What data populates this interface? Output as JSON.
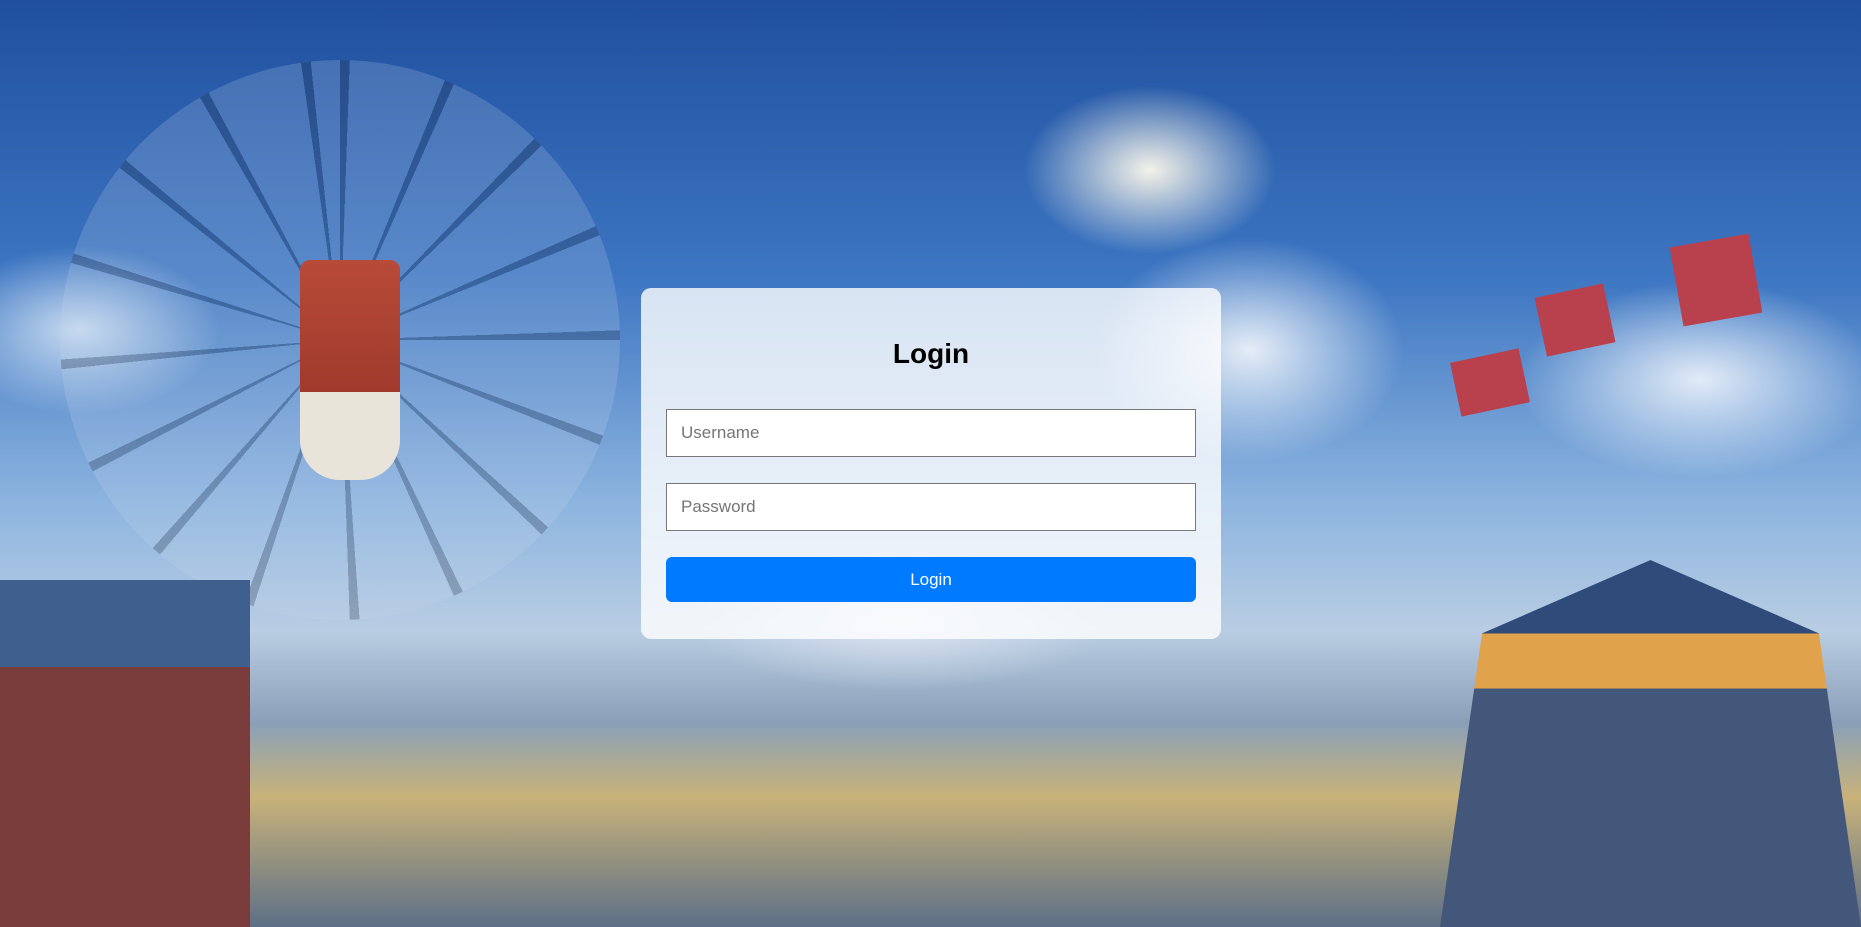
{
  "login_form": {
    "title": "Login",
    "username_placeholder": "Username",
    "password_placeholder": "Password",
    "submit_label": "Login"
  },
  "colors": {
    "accent": "#007bff"
  }
}
